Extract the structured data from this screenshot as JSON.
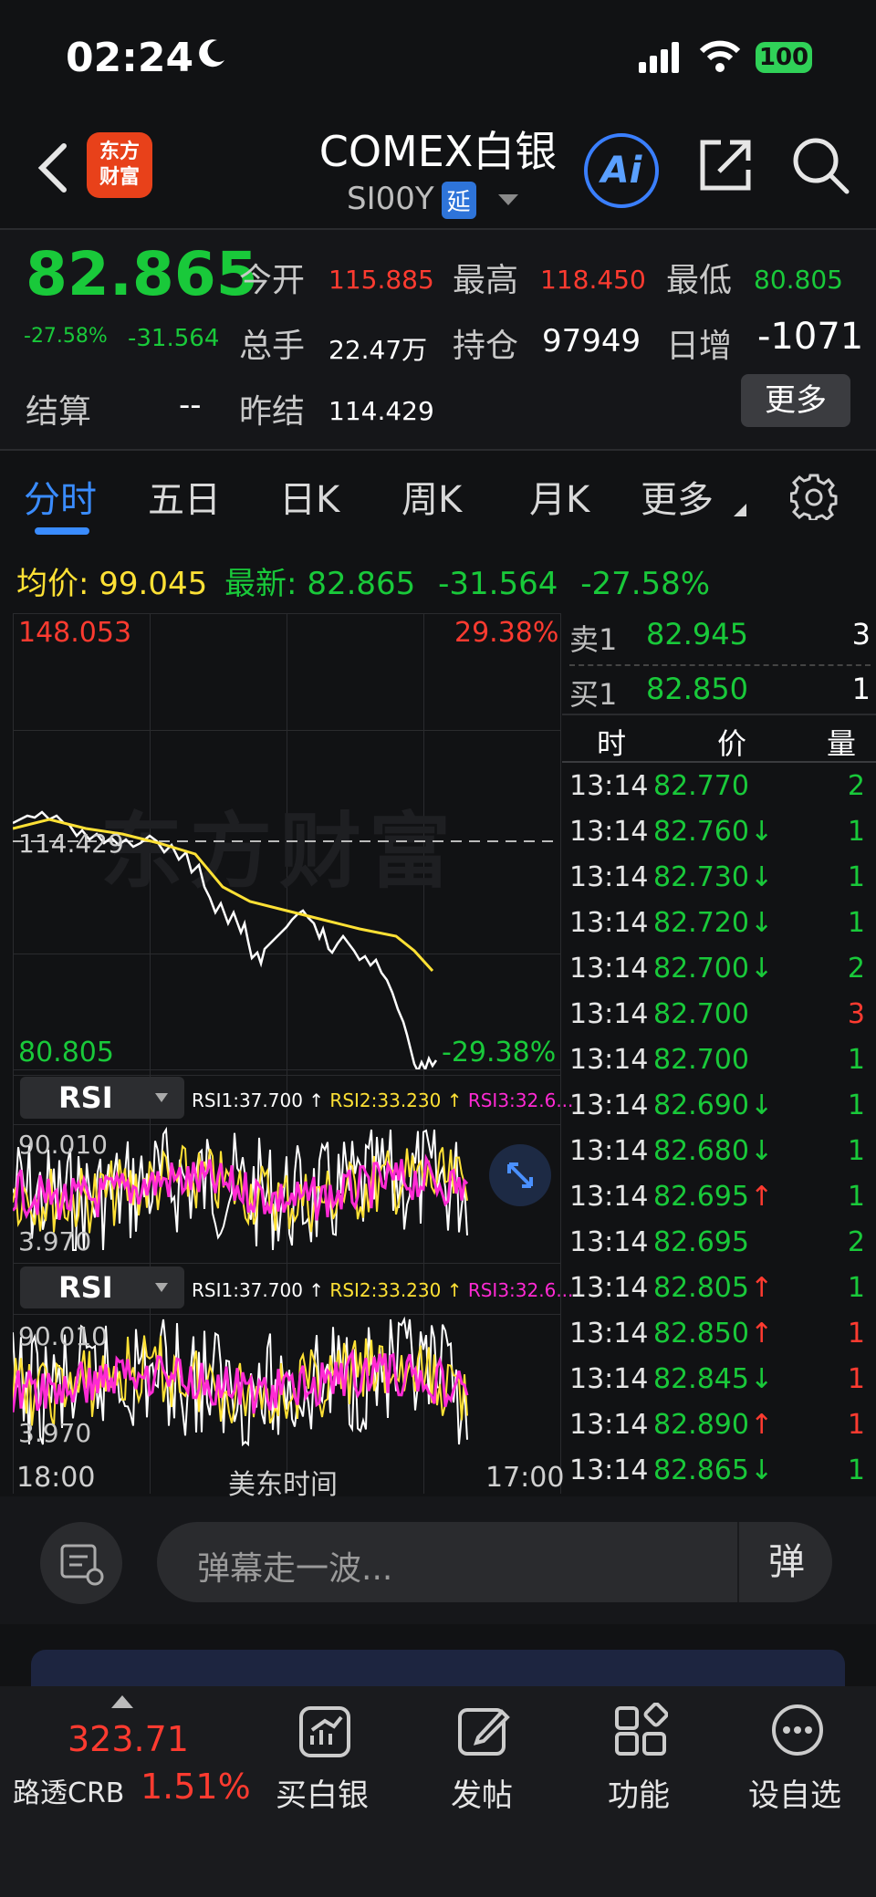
{
  "status": {
    "time": "02:24",
    "battery": "100"
  },
  "header": {
    "title": "COMEX白银",
    "symbol": "SI00Y",
    "delay_badge": "延",
    "logo_text_1": "东方",
    "logo_text_2": "财富",
    "ai_label": "Ai"
  },
  "quote": {
    "price": "82.865",
    "change_pct": "-27.58%",
    "change": "-31.564",
    "open_label": "今开",
    "open": "115.885",
    "high_label": "最高",
    "high": "118.450",
    "low_label": "最低",
    "low": "80.805",
    "volume_label": "总手",
    "volume": "22.47万",
    "oi_label": "持仓",
    "oi": "97949",
    "daily_inc_label": "日增",
    "daily_inc": "-1071",
    "settle_label": "结算",
    "settle": "--",
    "prev_settle_label": "昨结",
    "prev_settle": "114.429",
    "more_button": "更多"
  },
  "tabs": [
    "分时",
    "五日",
    "日K",
    "周K",
    "月K",
    "更多"
  ],
  "summary": {
    "avg_label": "均价:",
    "avg": "99.045",
    "latest_label": "最新:",
    "latest": "82.865",
    "change": "-31.564",
    "change_pct": "-27.58%"
  },
  "chart": {
    "max_price": "148.053",
    "min_price": "80.805",
    "max_pct": "29.38%",
    "min_pct": "-29.38%",
    "ref_price": "114.429",
    "watermark": "东方财富",
    "x_start": "18:00",
    "x_mid": "美东时间",
    "x_end": "17:00"
  },
  "rsi": [
    {
      "name": "RSI",
      "rsi1": "RSI1:37.700 ↑",
      "rsi2": "RSI2:33.230 ↑",
      "rsi3": "RSI3:32.6...",
      "top": "90.010",
      "bottom": "3.970"
    },
    {
      "name": "RSI",
      "rsi1": "RSI1:37.700 ↑",
      "rsi2": "RSI2:33.230 ↑",
      "rsi3": "RSI3:32.6...",
      "top": "90.010",
      "bottom": "3.970"
    }
  ],
  "orderbook": {
    "sell_label": "卖1",
    "sell_price": "82.945",
    "sell_qty": "3",
    "buy_label": "买1",
    "buy_price": "82.850",
    "buy_qty": "1",
    "head_time": "时",
    "head_price": "价",
    "head_qty": "量",
    "trades": [
      {
        "t": "13:14",
        "p": "82.770",
        "a": "",
        "q": "2",
        "qc": "green"
      },
      {
        "t": "13:14",
        "p": "82.760",
        "a": "↓",
        "q": "1",
        "qc": "green"
      },
      {
        "t": "13:14",
        "p": "82.730",
        "a": "↓",
        "q": "1",
        "qc": "green"
      },
      {
        "t": "13:14",
        "p": "82.720",
        "a": "↓",
        "q": "1",
        "qc": "green"
      },
      {
        "t": "13:14",
        "p": "82.700",
        "a": "↓",
        "q": "2",
        "qc": "green"
      },
      {
        "t": "13:14",
        "p": "82.700",
        "a": "",
        "q": "3",
        "qc": "red"
      },
      {
        "t": "13:14",
        "p": "82.700",
        "a": "",
        "q": "1",
        "qc": "green"
      },
      {
        "t": "13:14",
        "p": "82.690",
        "a": "↓",
        "q": "1",
        "qc": "green"
      },
      {
        "t": "13:14",
        "p": "82.680",
        "a": "↓",
        "q": "1",
        "qc": "green"
      },
      {
        "t": "13:14",
        "p": "82.695",
        "a": "↑",
        "q": "1",
        "qc": "green"
      },
      {
        "t": "13:14",
        "p": "82.695",
        "a": "",
        "q": "2",
        "qc": "green"
      },
      {
        "t": "13:14",
        "p": "82.805",
        "a": "↑",
        "q": "1",
        "qc": "green"
      },
      {
        "t": "13:14",
        "p": "82.850",
        "a": "↑",
        "q": "1",
        "qc": "red"
      },
      {
        "t": "13:14",
        "p": "82.845",
        "a": "↓",
        "q": "1",
        "qc": "red"
      },
      {
        "t": "13:14",
        "p": "82.890",
        "a": "↑",
        "q": "1",
        "qc": "red"
      },
      {
        "t": "13:14",
        "p": "82.865",
        "a": "↓",
        "q": "1",
        "qc": "green"
      }
    ]
  },
  "comment": {
    "placeholder": "弹幕走一波...",
    "danmu_button": "弹"
  },
  "bottom_nav": {
    "index_value": "323.71",
    "index_name": "路透CRB",
    "index_pct": "1.51%",
    "items": [
      "买白银",
      "发帖",
      "功能",
      "设自选"
    ]
  },
  "colors": {
    "up": "#ff3b30",
    "down": "#19c93a",
    "avg_line": "#ffe135",
    "accent": "#3a8cff"
  }
}
